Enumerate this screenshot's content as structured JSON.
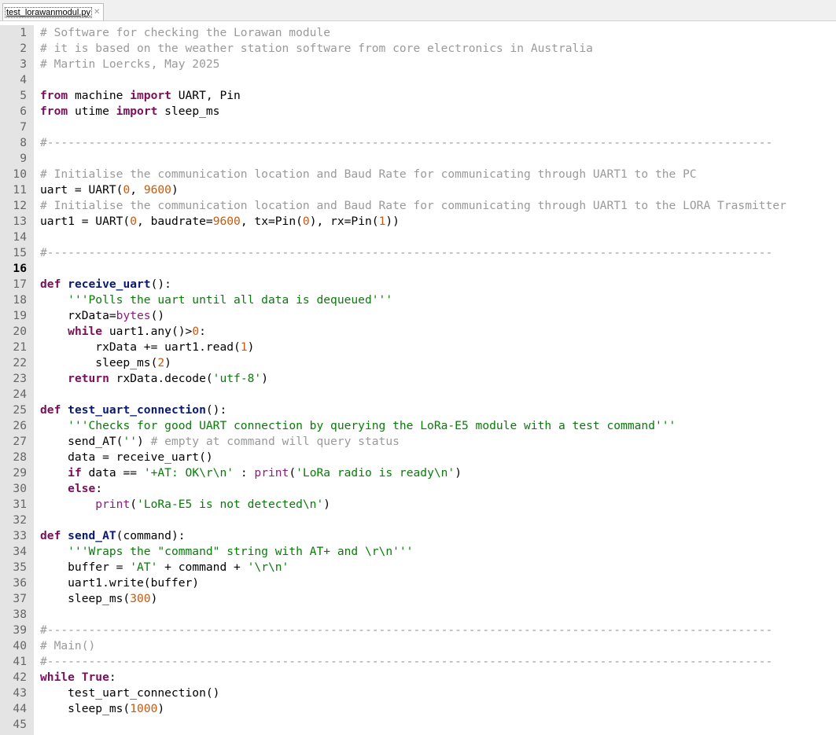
{
  "tab": {
    "label": "test_lorawanmodul.py",
    "close_icon": "close-icon"
  },
  "editor": {
    "current_line": 16,
    "lines": [
      [
        [
          "cm",
          "# Software for checking the Lorawan module"
        ]
      ],
      [
        [
          "cm",
          "# it is based on the weather station software from core electronics in Australia"
        ]
      ],
      [
        [
          "cm",
          "# Martin Loercks, May 2025"
        ]
      ],
      [],
      [
        [
          "kw",
          "from"
        ],
        [
          "p",
          " machine "
        ],
        [
          "kw",
          "import"
        ],
        [
          "p",
          " UART, Pin"
        ]
      ],
      [
        [
          "kw",
          "from"
        ],
        [
          "p",
          " utime "
        ],
        [
          "kw",
          "import"
        ],
        [
          "p",
          " sleep_ms"
        ]
      ],
      [],
      [
        [
          "cm",
          "#---------------------------------------------------------------------------------------------------------"
        ]
      ],
      [],
      [
        [
          "cm",
          "# Initialise the communication location and Baud Rate for communicating through UART1 to the PC"
        ]
      ],
      [
        [
          "p",
          "uart = UART("
        ],
        [
          "num",
          "0"
        ],
        [
          "p",
          ", "
        ],
        [
          "num",
          "9600"
        ],
        [
          "p",
          ")"
        ]
      ],
      [
        [
          "cm",
          "# Initialise the communication location and Baud Rate for communicating through UART1 to the LORA Trasmitter"
        ]
      ],
      [
        [
          "p",
          "uart1 = UART("
        ],
        [
          "num",
          "0"
        ],
        [
          "p",
          ", baudrate="
        ],
        [
          "num",
          "9600"
        ],
        [
          "p",
          ", tx=Pin("
        ],
        [
          "num",
          "0"
        ],
        [
          "p",
          "), rx=Pin("
        ],
        [
          "num",
          "1"
        ],
        [
          "p",
          "))"
        ]
      ],
      [],
      [
        [
          "cm",
          "#---------------------------------------------------------------------------------------------------------"
        ]
      ],
      [],
      [
        [
          "kw",
          "def"
        ],
        [
          "p",
          " "
        ],
        [
          "fn",
          "receive_uart"
        ],
        [
          "p",
          "():"
        ]
      ],
      [
        [
          "p",
          "    "
        ],
        [
          "str",
          "'''Polls the uart until all data is dequeued'''"
        ]
      ],
      [
        [
          "p",
          "    rxData="
        ],
        [
          "bi",
          "bytes"
        ],
        [
          "p",
          "()"
        ]
      ],
      [
        [
          "p",
          "    "
        ],
        [
          "kw",
          "while"
        ],
        [
          "p",
          " uart1.any()>"
        ],
        [
          "num",
          "0"
        ],
        [
          "p",
          ":"
        ]
      ],
      [
        [
          "p",
          "        rxData += uart1.read("
        ],
        [
          "num",
          "1"
        ],
        [
          "p",
          ")"
        ]
      ],
      [
        [
          "p",
          "        sleep_ms("
        ],
        [
          "num",
          "2"
        ],
        [
          "p",
          ")"
        ]
      ],
      [
        [
          "p",
          "    "
        ],
        [
          "kw",
          "return"
        ],
        [
          "p",
          " rxData.decode("
        ],
        [
          "str",
          "'utf-8'"
        ],
        [
          "p",
          ")"
        ]
      ],
      [],
      [
        [
          "kw",
          "def"
        ],
        [
          "p",
          " "
        ],
        [
          "fn",
          "test_uart_connection"
        ],
        [
          "p",
          "():"
        ]
      ],
      [
        [
          "p",
          "    "
        ],
        [
          "str",
          "'''Checks for good UART connection by querying the LoRa-E5 module with a test command'''"
        ]
      ],
      [
        [
          "p",
          "    send_AT("
        ],
        [
          "str",
          "''"
        ],
        [
          "p",
          ") "
        ],
        [
          "cm",
          "# empty at command will query status"
        ]
      ],
      [
        [
          "p",
          "    data = receive_uart()"
        ]
      ],
      [
        [
          "p",
          "    "
        ],
        [
          "kw",
          "if"
        ],
        [
          "p",
          " data == "
        ],
        [
          "str",
          "'+AT: OK\\r\\n'"
        ],
        [
          "p",
          " : "
        ],
        [
          "bi",
          "print"
        ],
        [
          "p",
          "("
        ],
        [
          "str",
          "'LoRa radio is ready\\n'"
        ],
        [
          "p",
          ")"
        ]
      ],
      [
        [
          "p",
          "    "
        ],
        [
          "kw",
          "else"
        ],
        [
          "p",
          ":"
        ]
      ],
      [
        [
          "p",
          "        "
        ],
        [
          "bi",
          "print"
        ],
        [
          "p",
          "("
        ],
        [
          "str",
          "'LoRa-E5 is not detected\\n'"
        ],
        [
          "p",
          ")"
        ]
      ],
      [],
      [
        [
          "kw",
          "def"
        ],
        [
          "p",
          " "
        ],
        [
          "fn",
          "send_AT"
        ],
        [
          "p",
          "(command):"
        ]
      ],
      [
        [
          "p",
          "    "
        ],
        [
          "str",
          "'''Wraps the \"command\" string with AT+ and \\r\\n'''"
        ]
      ],
      [
        [
          "p",
          "    buffer = "
        ],
        [
          "str",
          "'AT'"
        ],
        [
          "p",
          " + command + "
        ],
        [
          "str",
          "'\\r\\n'"
        ]
      ],
      [
        [
          "p",
          "    uart1.write(buffer)"
        ]
      ],
      [
        [
          "p",
          "    sleep_ms("
        ],
        [
          "num",
          "300"
        ],
        [
          "p",
          ")"
        ]
      ],
      [],
      [
        [
          "cm",
          "#---------------------------------------------------------------------------------------------------------"
        ]
      ],
      [
        [
          "cm",
          "# Main()"
        ]
      ],
      [
        [
          "cm",
          "#---------------------------------------------------------------------------------------------------------"
        ]
      ],
      [
        [
          "kw",
          "while"
        ],
        [
          "p",
          " "
        ],
        [
          "kw",
          "True"
        ],
        [
          "p",
          ":"
        ]
      ],
      [
        [
          "p",
          "    test_uart_connection()"
        ]
      ],
      [
        [
          "p",
          "    sleep_ms("
        ],
        [
          "num",
          "1000"
        ],
        [
          "p",
          ")"
        ]
      ],
      []
    ]
  }
}
